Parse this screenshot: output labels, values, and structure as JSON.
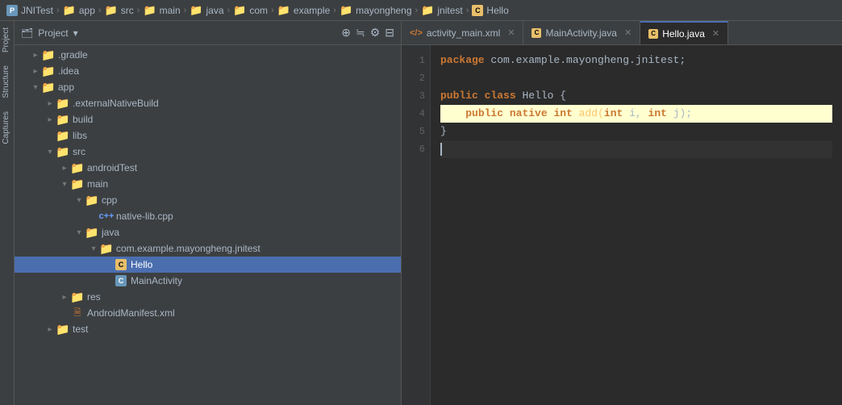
{
  "breadcrumb": {
    "items": [
      {
        "label": "JNITest",
        "type": "project"
      },
      {
        "label": "app",
        "type": "folder"
      },
      {
        "label": "src",
        "type": "folder"
      },
      {
        "label": "main",
        "type": "folder"
      },
      {
        "label": "java",
        "type": "folder"
      },
      {
        "label": "com",
        "type": "folder"
      },
      {
        "label": "example",
        "type": "folder"
      },
      {
        "label": "mayongheng",
        "type": "folder"
      },
      {
        "label": "jnitest",
        "type": "folder"
      },
      {
        "label": "Hello",
        "type": "class"
      }
    ]
  },
  "left_panel": {
    "title": "Project",
    "dropdown_arrow": "▾"
  },
  "tree": {
    "items": [
      {
        "id": "gradle",
        "label": ".gradle",
        "type": "folder",
        "indent": 1,
        "state": "closed"
      },
      {
        "id": "idea",
        "label": ".idea",
        "type": "folder",
        "indent": 1,
        "state": "closed"
      },
      {
        "id": "app",
        "label": "app",
        "type": "folder",
        "indent": 1,
        "state": "open"
      },
      {
        "id": "externalNativeBuild",
        "label": ".externalNativeBuild",
        "type": "folder",
        "indent": 2,
        "state": "closed"
      },
      {
        "id": "build",
        "label": "build",
        "type": "folder",
        "indent": 2,
        "state": "closed"
      },
      {
        "id": "libs",
        "label": "libs",
        "type": "folder",
        "indent": 2,
        "state": "leaf"
      },
      {
        "id": "src",
        "label": "src",
        "type": "folder",
        "indent": 2,
        "state": "open"
      },
      {
        "id": "androidTest",
        "label": "androidTest",
        "type": "folder",
        "indent": 3,
        "state": "closed"
      },
      {
        "id": "main",
        "label": "main",
        "type": "folder",
        "indent": 3,
        "state": "open"
      },
      {
        "id": "cpp",
        "label": "cpp",
        "type": "folder-blue",
        "indent": 4,
        "state": "open"
      },
      {
        "id": "native-lib",
        "label": "native-lib.cpp",
        "type": "file-cpp",
        "indent": 5,
        "state": "leaf"
      },
      {
        "id": "java",
        "label": "java",
        "type": "folder",
        "indent": 4,
        "state": "open"
      },
      {
        "id": "package",
        "label": "com.example.mayongheng.jnitest",
        "type": "folder",
        "indent": 5,
        "state": "open"
      },
      {
        "id": "Hello",
        "label": "Hello",
        "type": "class-c",
        "indent": 6,
        "state": "leaf",
        "selected": true
      },
      {
        "id": "MainActivity",
        "label": "MainActivity",
        "type": "class-c-blue",
        "indent": 6,
        "state": "leaf"
      },
      {
        "id": "res",
        "label": "res",
        "type": "folder",
        "indent": 3,
        "state": "closed"
      },
      {
        "id": "AndroidManifest",
        "label": "AndroidManifest.xml",
        "type": "file-xml",
        "indent": 3,
        "state": "leaf"
      },
      {
        "id": "test",
        "label": "test",
        "type": "folder",
        "indent": 2,
        "state": "closed"
      }
    ]
  },
  "editor": {
    "tabs": [
      {
        "label": "activity_main.xml",
        "type": "xml",
        "active": false
      },
      {
        "label": "MainActivity.java",
        "type": "java",
        "active": false
      },
      {
        "label": "Hello.java",
        "type": "class-c",
        "active": true
      }
    ],
    "code_lines": [
      {
        "num": 1,
        "content": "package com.example.mayongheng.jnitest;",
        "tokens": [
          {
            "text": "package",
            "cls": "kw"
          },
          {
            "text": " com.example.mayongheng.jnitest;",
            "cls": "pkg"
          }
        ]
      },
      {
        "num": 2,
        "content": ""
      },
      {
        "num": 3,
        "content": "public class Hello {",
        "tokens": [
          {
            "text": "public",
            "cls": "kw"
          },
          {
            "text": " ",
            "cls": "punc"
          },
          {
            "text": "class",
            "cls": "kw"
          },
          {
            "text": " Hello {",
            "cls": "cn"
          }
        ]
      },
      {
        "num": 4,
        "content": "    public native int add(int i, int j);",
        "tokens": [
          {
            "text": "    ",
            "cls": "punc"
          },
          {
            "text": "public",
            "cls": "kw"
          },
          {
            "text": " ",
            "cls": "punc"
          },
          {
            "text": "native",
            "cls": "kw-native"
          },
          {
            "text": " ",
            "cls": "punc"
          },
          {
            "text": "int",
            "cls": "kw-type"
          },
          {
            "text": " add(",
            "cls": "fn"
          },
          {
            "text": "int",
            "cls": "kw-type"
          },
          {
            "text": " i, ",
            "cls": "param"
          },
          {
            "text": "int",
            "cls": "kw-type"
          },
          {
            "text": " j);",
            "cls": "param"
          }
        ]
      },
      {
        "num": 5,
        "content": "}",
        "tokens": [
          {
            "text": "}",
            "cls": "punc"
          }
        ]
      },
      {
        "num": 6,
        "content": "",
        "cursor": true
      }
    ]
  },
  "icons": {
    "project": "📁",
    "folder": "▶",
    "sync": "⟳",
    "gear": "⚙",
    "filter": "≡"
  }
}
